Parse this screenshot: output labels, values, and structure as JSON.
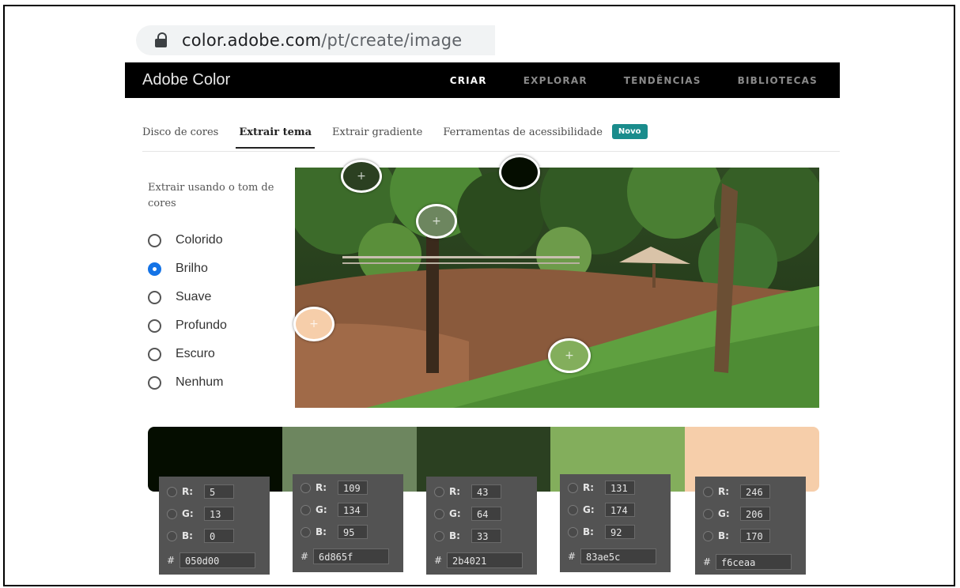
{
  "browser": {
    "url_host": "color.adobe.com",
    "url_path": "/pt/create/image"
  },
  "app": {
    "brand": "Adobe Color"
  },
  "topnav": [
    {
      "label": "CRIAR",
      "active": true
    },
    {
      "label": "EXPLORAR",
      "active": false
    },
    {
      "label": "TENDÊNCIAS",
      "active": false
    },
    {
      "label": "BIBLIOTECAS",
      "active": false
    }
  ],
  "subtabs": {
    "disco": "Disco de cores",
    "extrair_tema": "Extrair tema",
    "extrair_gradiente": "Extrair gradiente",
    "acessibilidade": "Ferramentas de acessibilidade",
    "badge": "Novo"
  },
  "mood": {
    "label": "Extrair usando o tom de cores",
    "options": [
      "Colorido",
      "Brilho",
      "Suave",
      "Profundo",
      "Escuro",
      "Nenhum"
    ],
    "selected": "Brilho"
  },
  "palette": [
    {
      "hex": "050d00",
      "r": "5",
      "g": "13",
      "b": "0",
      "color": "#050d00"
    },
    {
      "hex": "6d865f",
      "r": "109",
      "g": "134",
      "b": "95",
      "color": "#6d865f"
    },
    {
      "hex": "2b4021",
      "r": "43",
      "g": "64",
      "b": "33",
      "color": "#2b4021"
    },
    {
      "hex": "83ae5c",
      "r": "131",
      "g": "174",
      "b": "92",
      "color": "#83ae5c"
    },
    {
      "hex": "f6ceaa",
      "r": "246",
      "g": "206",
      "b": "170",
      "color": "#f6ceaa"
    }
  ],
  "labels": {
    "r": "R:",
    "g": "G:",
    "b": "B:",
    "hash": "#",
    "plus": "+"
  }
}
